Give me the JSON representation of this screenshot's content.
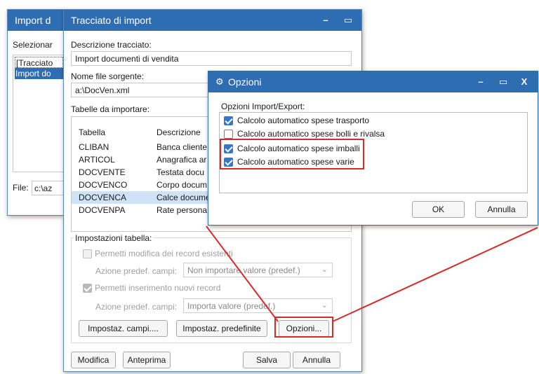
{
  "back_window": {
    "title": "Import d",
    "select_label": "Selezionar",
    "list_items": [
      "[Tracciato",
      "Import do"
    ],
    "file_label": "File:",
    "file_value": "c:\\az"
  },
  "main_window": {
    "title": "Tracciato di import",
    "desc_label": "Descrizione tracciato:",
    "desc_value": "Import documenti di vendita",
    "source_label": "Nome file sorgente:",
    "source_value": "a:\\DocVen.xml",
    "tables_label": "Tabelle da importare:",
    "columns": [
      "Tabella",
      "Descrizione"
    ],
    "rows": [
      {
        "tabella": "CLIBAN",
        "descrizione": "Banca cliente"
      },
      {
        "tabella": "ARTICOL",
        "descrizione": "Anagrafica ar"
      },
      {
        "tabella": "DOCVENTE",
        "descrizione": "Testata docu"
      },
      {
        "tabella": "DOCVENCO",
        "descrizione": "Corpo docum"
      },
      {
        "tabella": "DOCVENCA",
        "descrizione": "Calce docume"
      },
      {
        "tabella": "DOCVENPA",
        "descrizione": "Rate persona"
      }
    ],
    "selected_row": "DOCVENCA",
    "settings_group_label": "Impostazioni tabella:",
    "allow_modify_label": "Permetti modifica dei record esistenti",
    "allow_modify_checked": false,
    "action_label_1": "Azione predef. campi:",
    "action_value_1": "Non importare valore (predef.)",
    "allow_insert_label": "Permetti inserimento nuovi record",
    "allow_insert_checked": true,
    "action_label_2": "Azione predef. campi:",
    "action_value_2": "Importa valore (predef.)",
    "btn_field_settings": "Impostaz. campi....",
    "btn_default_settings": "Impostaz. predefinite",
    "btn_options": "Opzioni...",
    "btn_modify": "Modifica",
    "btn_preview": "Anteprima",
    "btn_save": "Salva",
    "btn_cancel": "Annulla"
  },
  "options_dialog": {
    "title": "Opzioni",
    "group_label": "Opzioni Import/Export:",
    "options": [
      {
        "label": "Calcolo automatico spese trasporto",
        "checked": true
      },
      {
        "label": "Calcolo automatico spese bolli e rivalsa",
        "checked": false
      },
      {
        "label": "Calcolo automatico spese imballi",
        "checked": true
      },
      {
        "label": "Calcolo automatico spese varie",
        "checked": true
      }
    ],
    "ok_label": "OK",
    "cancel_label": "Annulla"
  },
  "window_controls": {
    "minimize": "–",
    "maximize": "▭",
    "close": "X"
  },
  "colors": {
    "titlebar": "#2f6db3",
    "selection": "#cfe3f7",
    "highlight": "#d62b2b",
    "checkbox": "#3478c9"
  }
}
